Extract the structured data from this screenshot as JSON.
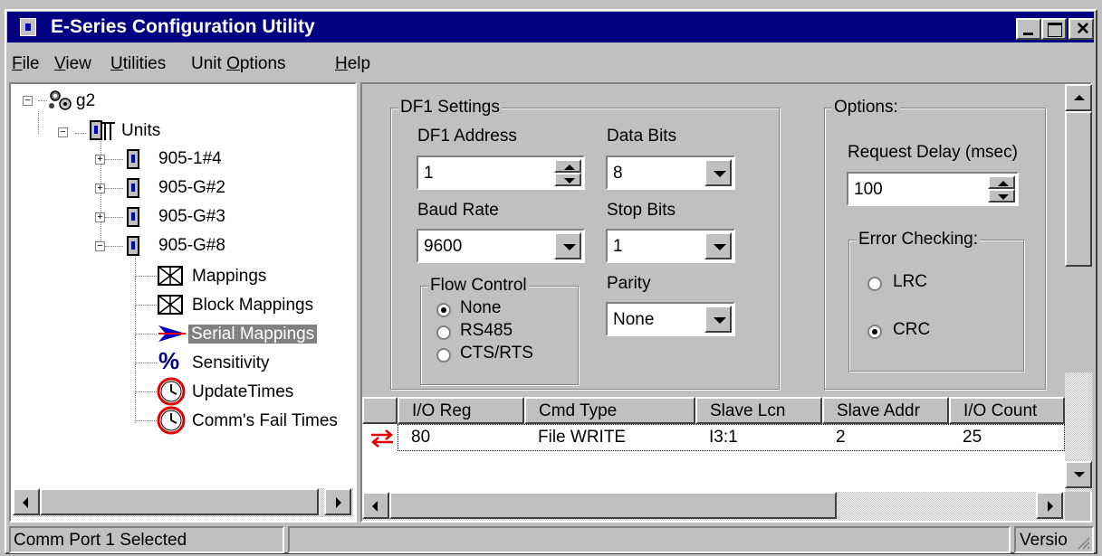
{
  "window": {
    "title": "E-Series Configuration Utility"
  },
  "menu": [
    "File",
    "View",
    "Utilities",
    "Unit Options",
    "Help"
  ],
  "tree": {
    "root": "g2",
    "units": "Units",
    "unit_items": [
      "905-1#4",
      "905-G#2",
      "905-G#3",
      "905-G#8"
    ],
    "children": [
      "Mappings",
      "Block Mappings",
      "Serial Mappings",
      "Sensitivity",
      "UpdateTimes",
      "Comm's Fail Times"
    ],
    "selected": "Serial Mappings"
  },
  "df1": {
    "group_label": "DF1 Settings",
    "address_label": "DF1 Address",
    "address_value": "1",
    "data_bits_label": "Data Bits",
    "data_bits_value": "8",
    "baud_label": "Baud Rate",
    "baud_value": "9600",
    "stop_bits_label": "Stop Bits",
    "stop_bits_value": "1",
    "flow_label": "Flow Control",
    "flow_options": [
      "None",
      "RS485",
      "CTS/RTS"
    ],
    "flow_selected": "None",
    "parity_label": "Parity",
    "parity_value": "None"
  },
  "options": {
    "group_label": "Options:",
    "delay_label": "Request Delay (msec)",
    "delay_value": "100",
    "error_label": "Error Checking:",
    "error_options": [
      "LRC",
      "CRC"
    ],
    "error_selected": "CRC"
  },
  "grid": {
    "columns": [
      "I/O Reg",
      "Cmd Type",
      "Slave Lcn",
      "Slave Addr",
      "I/O Count"
    ],
    "rows": [
      [
        "80",
        "File WRITE",
        "I3:1",
        "2",
        "25"
      ]
    ]
  },
  "status": {
    "left": "Comm Port 1 Selected",
    "right": "Versio"
  },
  "colors": {
    "titlebar": "#000080",
    "face": "#c0c0c0",
    "arrow_icon": "#e00000",
    "serial_icon": "#0000c0"
  }
}
